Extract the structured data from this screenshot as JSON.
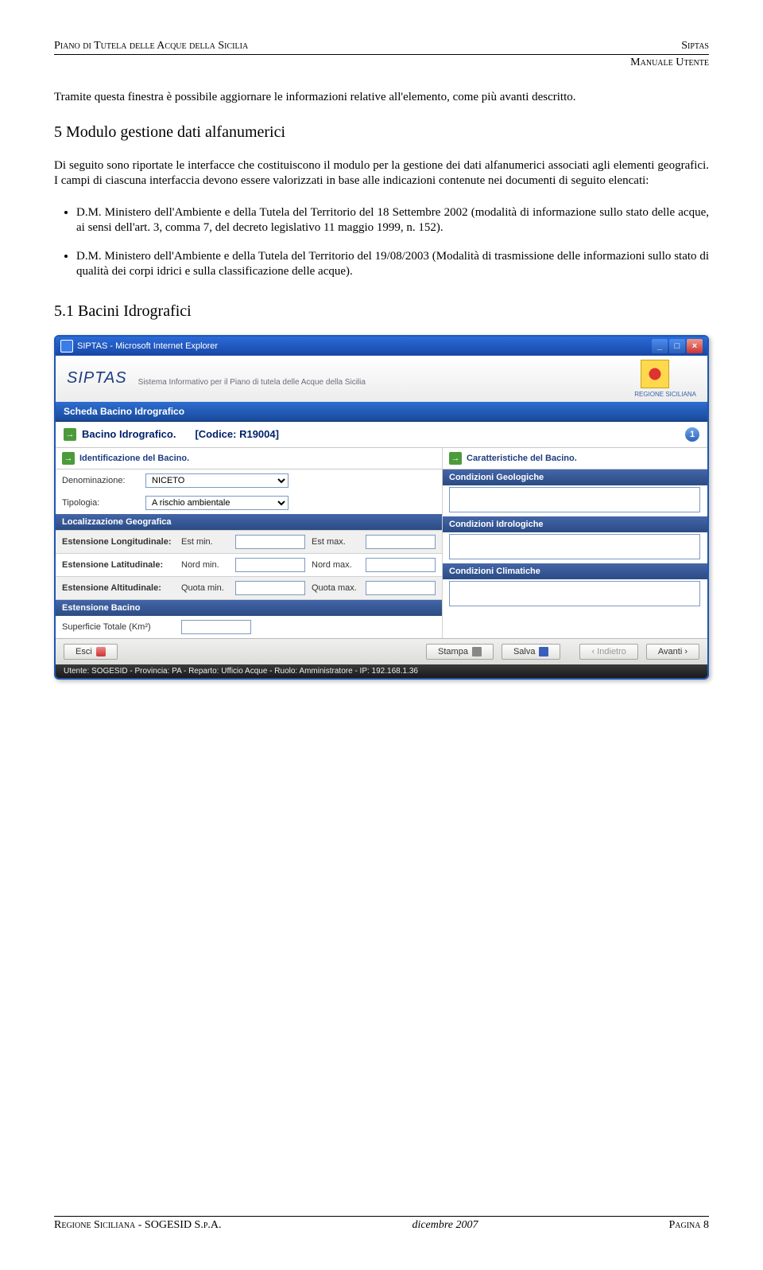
{
  "header": {
    "left": "Piano di Tutela delle Acque  della Sicilia",
    "right": "Siptas",
    "right2": "Manuale Utente"
  },
  "p1": "Tramite questa finestra è possibile aggiornare le informazioni relative all'elemento, come più avanti descritto.",
  "h5": "5   Modulo gestione dati alfanumerici",
  "p2": "Di seguito sono riportate le interfacce che costituiscono il modulo per la gestione dei dati alfanumerici associati agli elementi geografici. I campi di ciascuna interfaccia devono essere valorizzati in base alle indicazioni contenute nei documenti di seguito elencati:",
  "li1": "D.M. Ministero dell'Ambiente e della Tutela del Territorio del 18 Settembre 2002 (modalità di informazione sullo stato delle acque, ai sensi dell'art. 3, comma 7, del decreto legislativo 11 maggio 1999, n. 152).",
  "li2": "D.M. Ministero dell'Ambiente e della Tutela del Territorio del 19/08/2003 (Modalità di trasmissione delle informazioni sullo stato di qualità dei corpi idrici e sulla classificazione delle acque).",
  "h51": "5.1    Bacini Idrografici",
  "ie": {
    "title": "SIPTAS - Microsoft Internet Explorer",
    "logo": "SIPTAS",
    "tagline": "Sistema  Informativo  per  il  Piano  di  tutela  delle  Acque  della  Sicilia",
    "region": "REGIONE SICILIANA",
    "bluebar": "Scheda Bacino Idrografico",
    "main": {
      "label": "Bacino Idrografico.",
      "code": "[Codice: R19004]",
      "step": "1"
    },
    "left": {
      "ident": "Identificazione del Bacino.",
      "denom_lbl": "Denominazione:",
      "denom": "NICETO",
      "tipo_lbl": "Tipologia:",
      "tipo": "A rischio ambientale",
      "loc": "Localizzazione Geografica",
      "lon_lbl": "Estensione Longitudinale:",
      "lon_min": "Est min.",
      "lon_max": "Est max.",
      "lat_lbl": "Estensione Latitudinale:",
      "lat_min": "Nord min.",
      "lat_max": "Nord max.",
      "alt_lbl": "Estensione Altitudinale:",
      "alt_min": "Quota min.",
      "alt_max": "Quota max.",
      "ext": "Estensione Bacino",
      "surf_lbl": "Superficie Totale (Km²)"
    },
    "right": {
      "car": "Caratteristiche del Bacino.",
      "geo": "Condizioni Geologiche",
      "idro": "Condizioni Idrologiche",
      "clim": "Condizioni Climatiche"
    },
    "buttons": {
      "esci": "Esci",
      "stampa": "Stampa",
      "salva": "Salva",
      "indietro": "‹  Indietro",
      "avanti": "Avanti  ›"
    },
    "status": "Utente: SOGESID - Provincia: PA - Reparto: Ufficio Acque - Ruolo: Amministratore - IP: 192.168.1.36"
  },
  "footer": {
    "left": "Regione Siciliana - SOGESID S.p.A.",
    "center": "dicembre 2007",
    "right": "Pagina 8"
  }
}
